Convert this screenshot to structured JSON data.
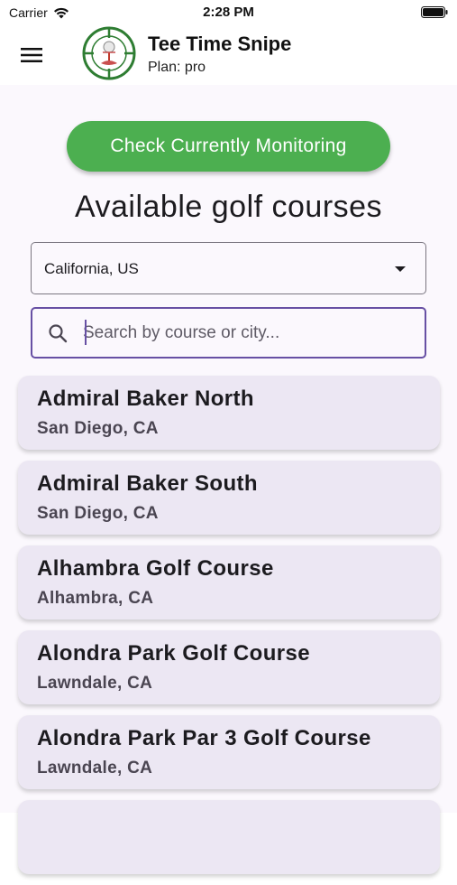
{
  "status_bar": {
    "carrier": "Carrier",
    "time": "2:28 PM"
  },
  "app_bar": {
    "title": "Tee Time Snipe",
    "plan": "Plan: pro",
    "brand_green": "#2e7d32"
  },
  "monitor_button": {
    "label": "Check Currently Monitoring",
    "color": "#4caf50"
  },
  "section_title": "Available golf courses",
  "region_select": {
    "value": "California, US"
  },
  "search": {
    "placeholder": "Search by course or city...",
    "value": "",
    "focus_color": "#6750a4"
  },
  "courses": [
    {
      "name": "Admiral Baker North",
      "city": "San Diego, CA"
    },
    {
      "name": "Admiral Baker South",
      "city": "San Diego, CA"
    },
    {
      "name": "Alhambra Golf Course",
      "city": "Alhambra, CA"
    },
    {
      "name": "Alondra Park Golf Course",
      "city": "Lawndale, CA"
    },
    {
      "name": "Alondra Park Par 3 Golf Course",
      "city": "Lawndale, CA"
    }
  ]
}
